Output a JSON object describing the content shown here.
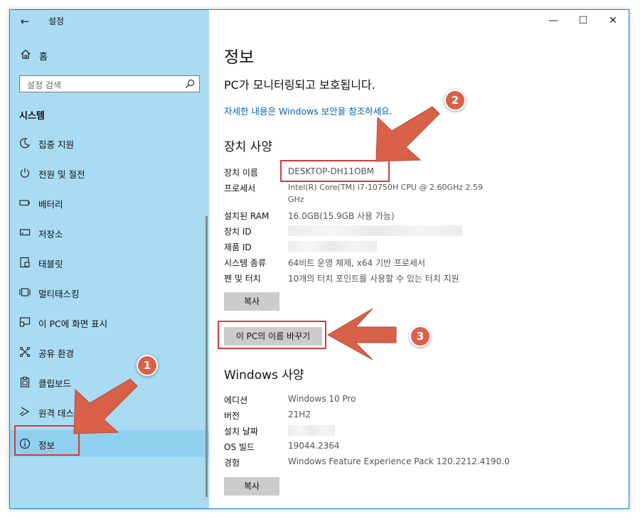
{
  "window": {
    "app_title": "설정",
    "back_label": "←",
    "minimize": "—",
    "maximize": "☐",
    "close": "✕"
  },
  "sidebar": {
    "home_label": "홈",
    "search_placeholder": "설정 검색",
    "section_title": "시스템",
    "items": [
      {
        "label": "집중 지원",
        "icon": "moon-icon"
      },
      {
        "label": "전원 및 절전",
        "icon": "power-icon"
      },
      {
        "label": "배터리",
        "icon": "battery-icon"
      },
      {
        "label": "저장소",
        "icon": "storage-icon"
      },
      {
        "label": "태블릿",
        "icon": "tablet-icon"
      },
      {
        "label": "멀티태스킹",
        "icon": "multitasking-icon"
      },
      {
        "label": "이 PC에 화면 표시",
        "icon": "project-icon"
      },
      {
        "label": "공유 환경",
        "icon": "share-icon"
      },
      {
        "label": "클립보드",
        "icon": "clipboard-icon"
      },
      {
        "label": "원격 데스",
        "icon": "remote-desktop-icon"
      },
      {
        "label": "정보",
        "icon": "info-icon",
        "selected": true
      }
    ]
  },
  "main": {
    "page_title": "정보",
    "protect_text": "PC가 모니터링되고 보호됩니다.",
    "security_link": "자세한 내용은 Windows 보안을 참조하세요.",
    "device_spec": {
      "heading": "장치 사양",
      "rows": [
        {
          "label": "장치 이름",
          "value": "DESKTOP-DH11OBM"
        },
        {
          "label": "프로세서",
          "value": "Intel(R) Core(TM) i7-10750H CPU @ 2.60GHz   2.59",
          "value2": "GHz"
        },
        {
          "label": "설치된 RAM",
          "value": "16.0GB(15.9GB 사용 가능)"
        },
        {
          "label": "장치 ID",
          "value": ""
        },
        {
          "label": "제품 ID",
          "value": ""
        },
        {
          "label": "시스템 종류",
          "value": "64비트 운영 체제, x64 기반 프로세서"
        },
        {
          "label": "펜 및 터치",
          "value": "10개의 터치 포인트를 사용할 수 있는 터치 지원"
        }
      ],
      "copy_button": "복사",
      "rename_button": "이 PC의 이름 바꾸기"
    },
    "windows_spec": {
      "heading": "Windows 사양",
      "rows": [
        {
          "label": "에디션",
          "value": "Windows 10 Pro"
        },
        {
          "label": "버전",
          "value": "21H2"
        },
        {
          "label": "설치 날짜",
          "value": ""
        },
        {
          "label": "OS 빌드",
          "value": "19044.2364"
        },
        {
          "label": "경험",
          "value": "Windows Feature Experience Pack 120.2212.4190.0"
        }
      ],
      "copy_button": "복사"
    }
  },
  "annotations": {
    "badges": [
      "1",
      "2",
      "3"
    ],
    "color": "#d9614a",
    "box_color": "#d23b3b"
  },
  "colors": {
    "sidebar_bg": "#a9dcf3",
    "selected_bg": "#8fd0ee",
    "link": "#0063b1",
    "button_bg": "#cccccc"
  }
}
